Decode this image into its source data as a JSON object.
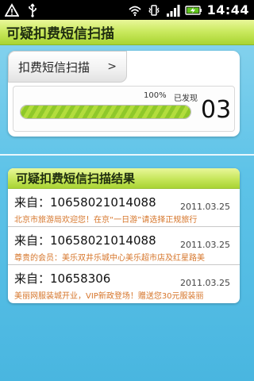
{
  "status_bar": {
    "time": "14:44",
    "icons": [
      "warning-icon",
      "usb-icon",
      "wifi-icon",
      "vibrate-icon",
      "signal-icon",
      "battery-charging-icon"
    ]
  },
  "title": "可疑扣费短信扫描",
  "scan_button": {
    "label": "扣费短信扫描",
    "arrow": ">"
  },
  "progress": {
    "percent_label": "100%",
    "value": 100,
    "found_label": "已发现",
    "count": "03"
  },
  "results": {
    "header": "可疑扣费短信扫描结果",
    "items": [
      {
        "sender": "来自：10658021014088",
        "date": "2011.03.25",
        "preview": "北京市旅游局欢迎您！在京“一日游”请选择正规旅行"
      },
      {
        "sender": "来自：10658021014088",
        "date": "2011.03.25",
        "preview": "尊贵的会员：美乐双井乐城中心美乐超市店及红星路美"
      },
      {
        "sender": "来自：10658306",
        "date": "2011.03.25",
        "preview": "美丽网服装城开业，VIP新政登场！赠送您30元服装丽"
      }
    ]
  },
  "colors": {
    "accent_green": "#b2dd3d",
    "preview_text": "#d6752a",
    "background": "#5ec3e8"
  }
}
